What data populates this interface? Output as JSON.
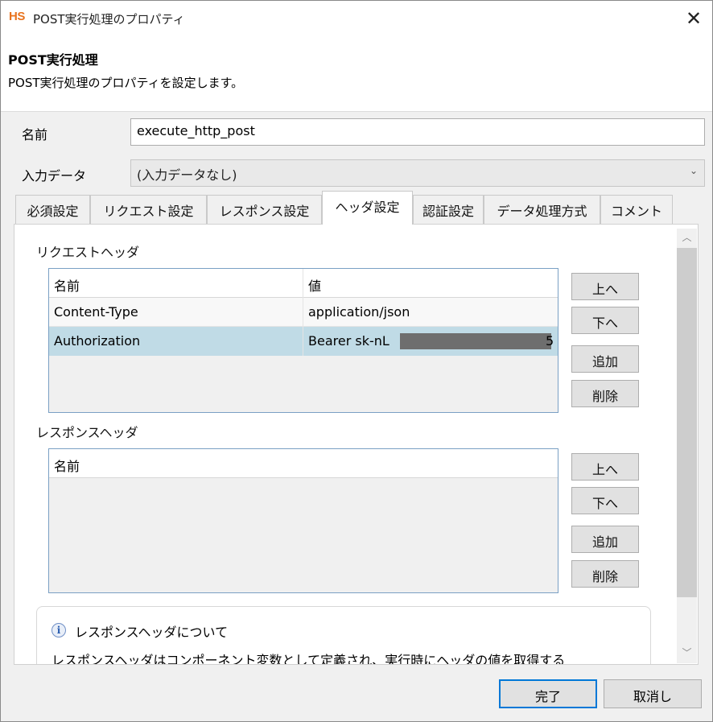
{
  "window": {
    "logo": "HS",
    "title": "POST実行処理のプロパティ",
    "close": "✕"
  },
  "header": {
    "title": "POST実行処理",
    "description": "POST実行処理のプロパティを設定します。"
  },
  "form": {
    "name_label": "名前",
    "name_value": "execute_http_post",
    "input_label": "入力データ",
    "input_value": "(入力データなし)",
    "input_arrow": "⌄"
  },
  "tabs": [
    {
      "label": "必須設定"
    },
    {
      "label": "リクエスト設定"
    },
    {
      "label": "レスポンス設定"
    },
    {
      "label": "ヘッダ設定",
      "active": true
    },
    {
      "label": "認証設定"
    },
    {
      "label": "データ処理方式"
    },
    {
      "label": "コメント"
    }
  ],
  "request_headers": {
    "label": "リクエストヘッダ",
    "columns": [
      "名前",
      "値"
    ],
    "rows": [
      {
        "name": "Content-Type",
        "value": "application/json"
      },
      {
        "name": "Authorization",
        "value": "Bearer sk-nL",
        "value_tail": "5"
      }
    ],
    "buttons": {
      "up": "上へ",
      "down": "下へ",
      "add": "追加",
      "delete": "削除"
    }
  },
  "response_headers": {
    "label": "レスポンスヘッダ",
    "columns": [
      "名前"
    ],
    "buttons": {
      "up": "上へ",
      "down": "下へ",
      "add": "追加",
      "delete": "削除"
    }
  },
  "info": {
    "icon": "i",
    "title": "レスポンスヘッダについて",
    "body": "レスポンスヘッダはコンポーネント変数として定義され、実行時にヘッダの値を取得する"
  },
  "scrollbar": {
    "up": "︿",
    "down": "﹀"
  },
  "footer": {
    "ok": "完了",
    "cancel": "取消し"
  }
}
